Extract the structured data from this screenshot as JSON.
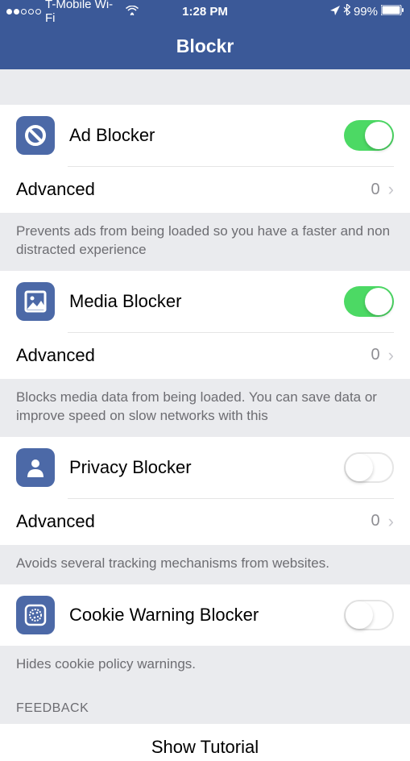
{
  "status": {
    "carrier": "T-Mobile Wi-Fi",
    "time": "1:28 PM",
    "battery": "99%"
  },
  "nav": {
    "title": "Blockr"
  },
  "sections": [
    {
      "title": "Ad Blocker",
      "icon": "block-icon",
      "toggle": true,
      "advanced": {
        "label": "Advanced",
        "value": "0"
      },
      "footer": "Prevents ads from being loaded so you have a faster and non distracted experience"
    },
    {
      "title": "Media Blocker",
      "icon": "image-icon",
      "toggle": true,
      "advanced": {
        "label": "Advanced",
        "value": "0"
      },
      "footer": "Blocks media data from being loaded. You can save data or improve speed on slow networks with this"
    },
    {
      "title": "Privacy Blocker",
      "icon": "person-icon",
      "toggle": false,
      "advanced": {
        "label": "Advanced",
        "value": "0"
      },
      "footer": "Avoids several tracking mechanisms from websites."
    },
    {
      "title": "Cookie Warning Blocker",
      "icon": "cookie-icon",
      "toggle": false,
      "footer": "Hides cookie policy warnings."
    }
  ],
  "feedback": {
    "header": "FEEDBACK",
    "tutorial": "Show Tutorial"
  }
}
